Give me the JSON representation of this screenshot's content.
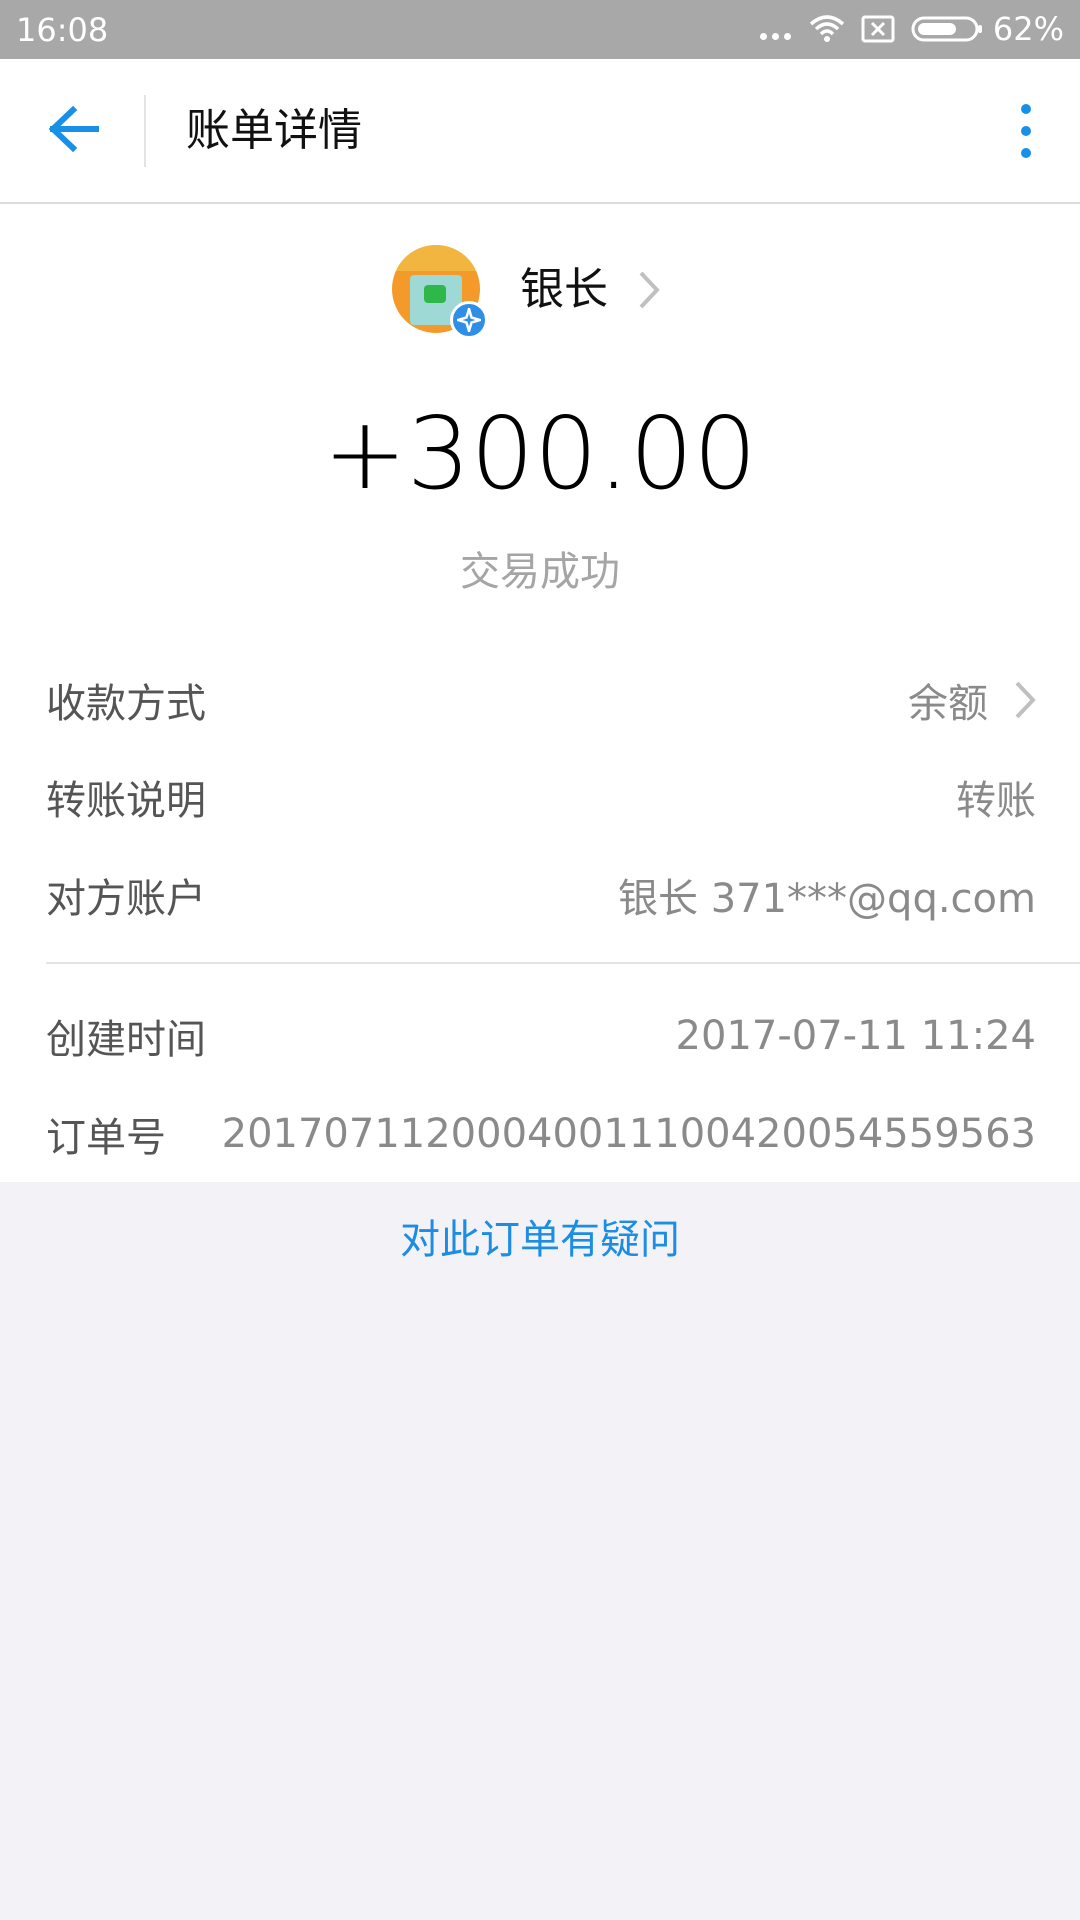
{
  "status_bar": {
    "time": "16:08",
    "battery_percent": "62%",
    "icons": [
      "more-dots-icon",
      "wifi-icon",
      "no-sim-icon",
      "battery-icon"
    ]
  },
  "header": {
    "title": "账单详情",
    "back_icon": "arrow-left-icon",
    "more_icon": "more-vertical-icon",
    "accent_color": "#1890e8"
  },
  "payee": {
    "name": "银长",
    "avatar_icon": "avatar-image",
    "badge_icon": "star-badge-icon"
  },
  "transaction": {
    "amount": "+300.00",
    "status": "交易成功"
  },
  "details": [
    {
      "label": "收款方式",
      "value": "余额",
      "has_chevron": true
    },
    {
      "label": "转账说明",
      "value": "转账",
      "has_chevron": false
    },
    {
      "label": "对方账户",
      "value": "银长 371***@qq.com",
      "has_chevron": false
    }
  ],
  "meta": [
    {
      "label": "创建时间",
      "value": "2017-07-11 11:24"
    },
    {
      "label": "订单号",
      "value": "20170711200040011100420054559563"
    }
  ],
  "footer": {
    "question_link": "对此订单有疑问",
    "link_color": "#1d8de4"
  }
}
